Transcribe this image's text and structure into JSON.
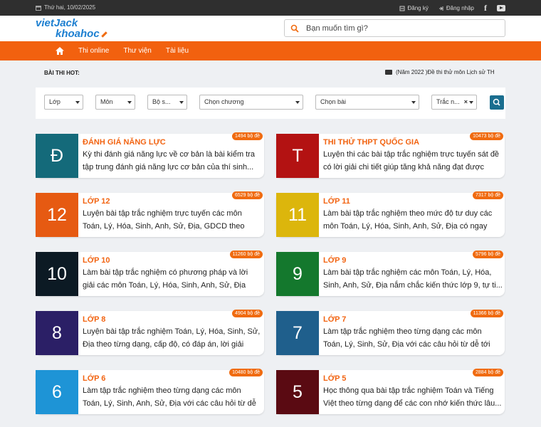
{
  "topbar": {
    "date": "Thứ hai, 10/02/2025",
    "register": "Đăng ký",
    "login": "Đăng nhập"
  },
  "header": {
    "logo_line1": "vietJack",
    "logo_line2": "khoahoc",
    "search_placeholder": "Bạn muốn tìm gì?"
  },
  "nav": {
    "items": [
      "Thi online",
      "Thư viện",
      "Tài liệu"
    ]
  },
  "hot": {
    "label": "BÀI THI HOT:",
    "news": "(Năm 2022 )Đề thi thử môn Lịch sử TH"
  },
  "filters": [
    "Lớp",
    "Môn",
    "Bộ s...",
    "Chọn chương",
    "Chọn bài",
    "Trắc n..."
  ],
  "colors": {
    "accent": "#f2610f",
    "topbar": "#2f2f2f",
    "search_button": "#1a6e8f"
  },
  "cards": [
    {
      "letter": "Đ",
      "color": "#146a7a",
      "title": "ĐÁNH GIÁ NĂNG LỰC",
      "desc": "Kỳ thi đánh giá năng lực về cơ bản là bài kiểm tra tập trung đánh giá năng lực cơ bản của thí sinh...",
      "count": "1494 bộ đề"
    },
    {
      "letter": "T",
      "color": "#b31212",
      "title": "THI THỬ THPT QUỐC GIA",
      "desc": "Luyện thi các bài tập trắc nghiệm trực tuyến sát đề có lời giải chi tiết giúp tăng khả năng đạt được điể...",
      "count": "10473 bộ đề"
    },
    {
      "letter": "12",
      "color": "#e65a12",
      "title": "LỚP 12",
      "desc": "Luyện bài tập trắc nghiệm trực tuyến các môn Toán, Lý, Hóa, Sinh, Anh, Sử, Địa, GDCD theo hướng...",
      "count": "6529 bộ đề"
    },
    {
      "letter": "11",
      "color": "#dcb60c",
      "title": "LỚP 11",
      "desc": "Làm bài tập trắc nghiệm theo mức độ tư duy các môn Toán, Lý, Hóa, Sinh, Anh, Sử, Địa có ngay đá...",
      "count": "7317 bộ đề"
    },
    {
      "letter": "10",
      "color": "#0c1a24",
      "title": "LỚP 10",
      "desc": "Làm bài tập trắc nghiệm có phương pháp và lời giải các môn Toán, Lý, Hóa, Sinh, Anh, Sử, Địa chắc...",
      "count": "11260 bộ đề"
    },
    {
      "letter": "9",
      "color": "#14782d",
      "title": "LỚP 9",
      "desc": "Làm bài tập trắc nghiệm các môn Toán, Lý, Hóa, Sinh, Anh, Sử, Địa nắm chắc kiến thức lớp 9, tự ti...",
      "count": "5796 bộ đề"
    },
    {
      "letter": "8",
      "color": "#2b1f66",
      "title": "LỚP 8",
      "desc": "Luyện bài tập trắc nghiệm Toán, Lý, Hóa, Sinh, Sử, Địa theo từng dạng, cấp độ, có đáp án, lời giải chi...",
      "count": "4904 bộ đề"
    },
    {
      "letter": "7",
      "color": "#1f5f8c",
      "title": "LỚP 7",
      "desc": "Làm tập trắc nghiệm theo từng dạng các môn Toán, Lý, Sinh, Sử, Địa với các câu hỏi từ dễ tới khó cô l...",
      "count": "11366 bộ đề"
    },
    {
      "letter": "6",
      "color": "#1e94d6",
      "title": "LỚP 6",
      "desc": "Làm tập trắc nghiệm theo từng dạng các môn Toán, Lý, Sinh, Anh, Sử, Địa với các câu hỏi từ dễ tới kh...",
      "count": "10480 bộ đề"
    },
    {
      "letter": "5",
      "color": "#5a0a12",
      "title": "LỚP 5",
      "desc": "Học thông qua bài tập trắc nghiệm Toán và Tiếng Việt theo từng dạng để các con nhớ kiến thức lâu...",
      "count": "2884 bộ đề"
    }
  ]
}
